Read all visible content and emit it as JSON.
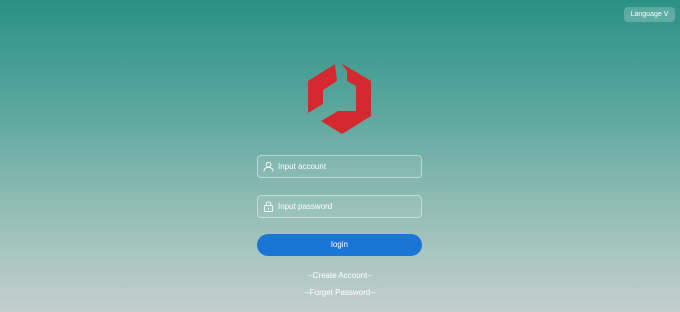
{
  "header": {
    "language_label": "Language V"
  },
  "logo": {
    "icon": "hexagon-logo-icon",
    "color": "#d42a2f"
  },
  "form": {
    "account_placeholder": "Input account",
    "account_value": "",
    "account_icon": "user-icon",
    "password_placeholder": "Input password",
    "password_value": "",
    "password_icon": "lock-icon",
    "login_label": "login",
    "login_color": "#1a76d6"
  },
  "links": {
    "create_account": "--Create Account--",
    "forget_password": "--Forget Password--"
  }
}
